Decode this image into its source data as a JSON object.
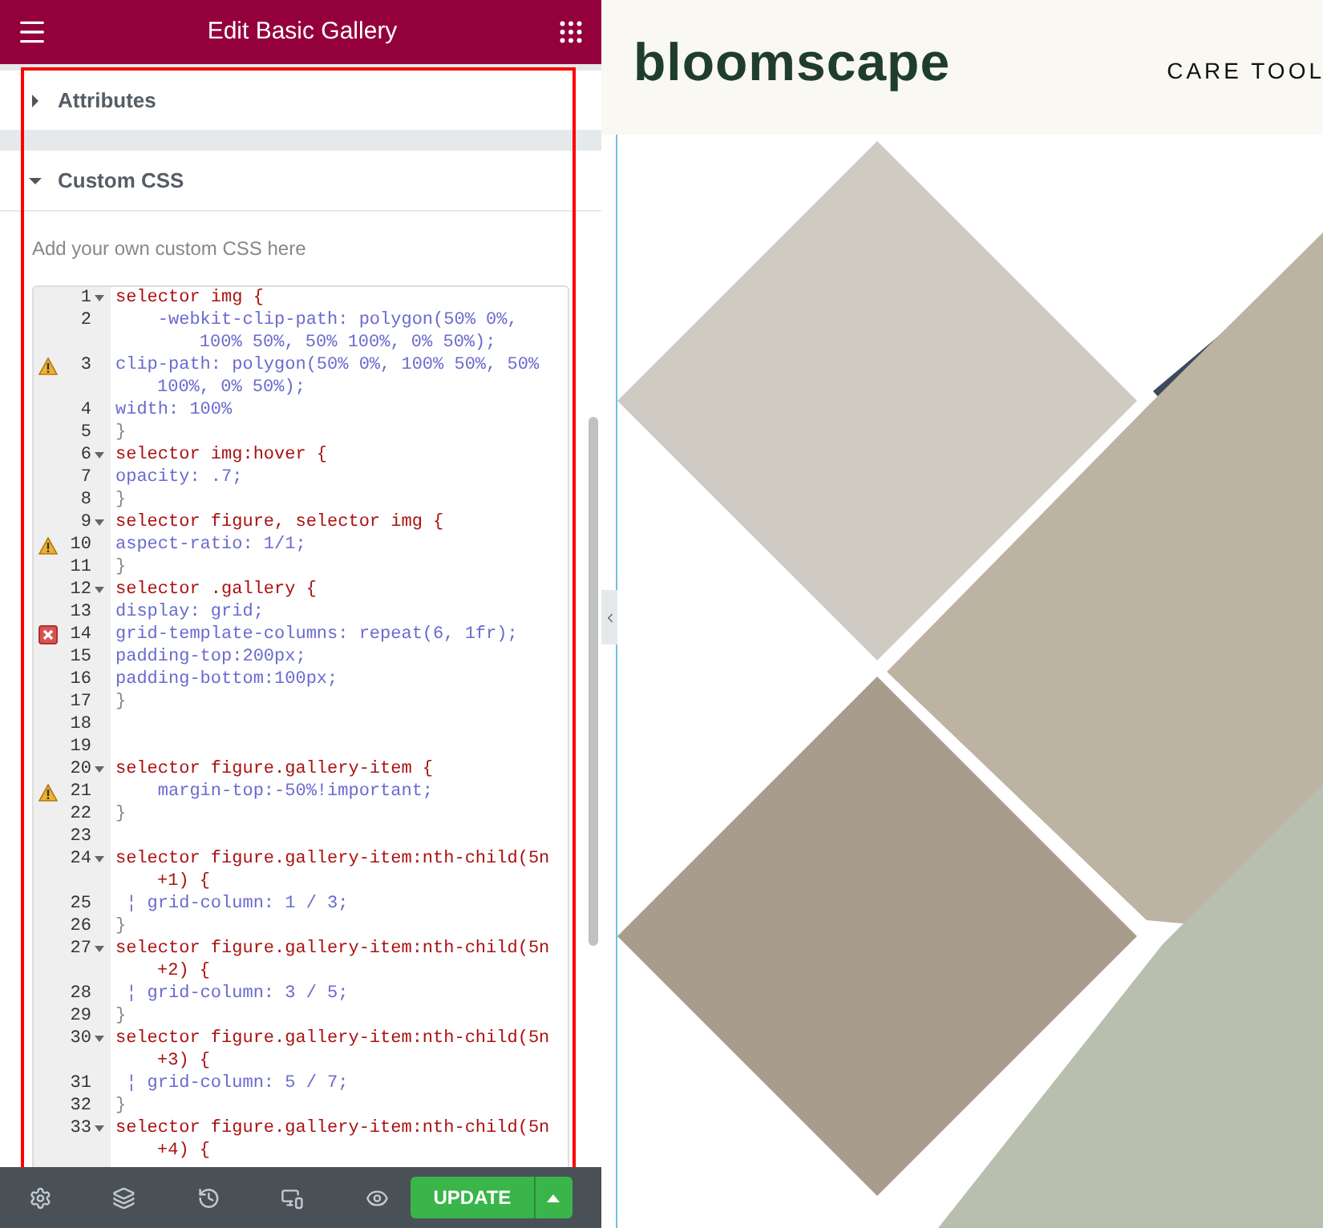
{
  "panel": {
    "title": "Edit Basic Gallery",
    "sections": [
      {
        "label": "Attributes",
        "expanded": false
      },
      {
        "label": "Custom CSS",
        "expanded": true
      }
    ],
    "description": "Add your own custom CSS here",
    "code_lines": [
      {
        "number": "1",
        "kind": "selector",
        "fold": true,
        "warning": false,
        "error": false,
        "text": "selector img {"
      },
      {
        "number": "2",
        "kind": "property",
        "fold": false,
        "warning": false,
        "error": false,
        "text": "    -webkit-clip-path: polygon(50% 0%,",
        "wrap": "    100% 50%, 50% 100%, 0% 50%);"
      },
      {
        "number": "3",
        "kind": "property",
        "fold": false,
        "warning": true,
        "error": false,
        "text": "clip-path: polygon(50% 0%, 100% 50%, 50%",
        "wrap": "100%, 0% 50%);"
      },
      {
        "number": "4",
        "kind": "property",
        "fold": false,
        "warning": false,
        "error": false,
        "text": "width: 100%"
      },
      {
        "number": "5",
        "kind": "brace",
        "fold": false,
        "warning": false,
        "error": false,
        "text": "}"
      },
      {
        "number": "6",
        "kind": "selector",
        "fold": true,
        "warning": false,
        "error": false,
        "text": "selector img:hover {"
      },
      {
        "number": "7",
        "kind": "property",
        "fold": false,
        "warning": false,
        "error": false,
        "text": "opacity: .7;"
      },
      {
        "number": "8",
        "kind": "brace",
        "fold": false,
        "warning": false,
        "error": false,
        "text": "}"
      },
      {
        "number": "9",
        "kind": "selector",
        "fold": true,
        "warning": false,
        "error": false,
        "text": "selector figure, selector img {"
      },
      {
        "number": "10",
        "kind": "property",
        "fold": false,
        "warning": true,
        "error": false,
        "text": "aspect-ratio: 1/1;"
      },
      {
        "number": "11",
        "kind": "brace",
        "fold": false,
        "warning": false,
        "error": false,
        "text": "}"
      },
      {
        "number": "12",
        "kind": "selector",
        "fold": true,
        "warning": false,
        "error": false,
        "text": "selector .gallery {"
      },
      {
        "number": "13",
        "kind": "property",
        "fold": false,
        "warning": false,
        "error": false,
        "text": "display: grid;"
      },
      {
        "number": "14",
        "kind": "property",
        "fold": false,
        "warning": false,
        "error": true,
        "text": "grid-template-columns: repeat(6, 1fr);"
      },
      {
        "number": "15",
        "kind": "property",
        "fold": false,
        "warning": false,
        "error": false,
        "text": "padding-top:200px;"
      },
      {
        "number": "16",
        "kind": "property",
        "fold": false,
        "warning": false,
        "error": false,
        "text": "padding-bottom:100px;"
      },
      {
        "number": "17",
        "kind": "brace",
        "fold": false,
        "warning": false,
        "error": false,
        "text": "}"
      },
      {
        "number": "18",
        "kind": "blank",
        "fold": false,
        "warning": false,
        "error": false
      },
      {
        "number": "19",
        "kind": "blank",
        "fold": false,
        "warning": false,
        "error": false
      },
      {
        "number": "20",
        "kind": "selector",
        "fold": true,
        "warning": false,
        "error": false,
        "text": "selector figure.gallery-item {"
      },
      {
        "number": "21",
        "kind": "property",
        "fold": false,
        "warning": true,
        "error": false,
        "text": "    margin-top:-50%!important;"
      },
      {
        "number": "22",
        "kind": "brace",
        "fold": false,
        "warning": false,
        "error": false,
        "text": "}"
      },
      {
        "number": "23",
        "kind": "blank",
        "fold": false,
        "warning": false,
        "error": false
      },
      {
        "number": "24",
        "kind": "selector",
        "fold": true,
        "warning": false,
        "error": false,
        "text": "selector figure.gallery-item:nth-child(5n",
        "wrap": "+1) {"
      },
      {
        "number": "25",
        "kind": "property",
        "fold": false,
        "warning": false,
        "error": false,
        "text": " ¦ grid-column: 1 / 3;"
      },
      {
        "number": "26",
        "kind": "brace",
        "fold": false,
        "warning": false,
        "error": false,
        "text": "}"
      },
      {
        "number": "27",
        "kind": "selector",
        "fold": true,
        "warning": false,
        "error": false,
        "text": "selector figure.gallery-item:nth-child(5n",
        "wrap": "+2) {"
      },
      {
        "number": "28",
        "kind": "property",
        "fold": false,
        "warning": false,
        "error": false,
        "text": " ¦ grid-column: 3 / 5;"
      },
      {
        "number": "29",
        "kind": "brace",
        "fold": false,
        "warning": false,
        "error": false,
        "text": "}"
      },
      {
        "number": "30",
        "kind": "selector",
        "fold": true,
        "warning": false,
        "error": false,
        "text": "selector figure.gallery-item:nth-child(5n",
        "wrap": "+3) {"
      },
      {
        "number": "31",
        "kind": "property",
        "fold": false,
        "warning": false,
        "error": false,
        "text": " ¦ grid-column: 5 / 7;"
      },
      {
        "number": "32",
        "kind": "brace",
        "fold": false,
        "warning": false,
        "error": false,
        "text": "}"
      },
      {
        "number": "33",
        "kind": "selector",
        "fold": true,
        "warning": false,
        "error": false,
        "text": "selector figure.gallery-item:nth-child(5n",
        "wrap": "+4) {"
      }
    ],
    "footer": {
      "update_label": "UPDATE"
    }
  },
  "preview": {
    "logo": "bloomscape",
    "nav_item": "CARE TOOL"
  }
}
